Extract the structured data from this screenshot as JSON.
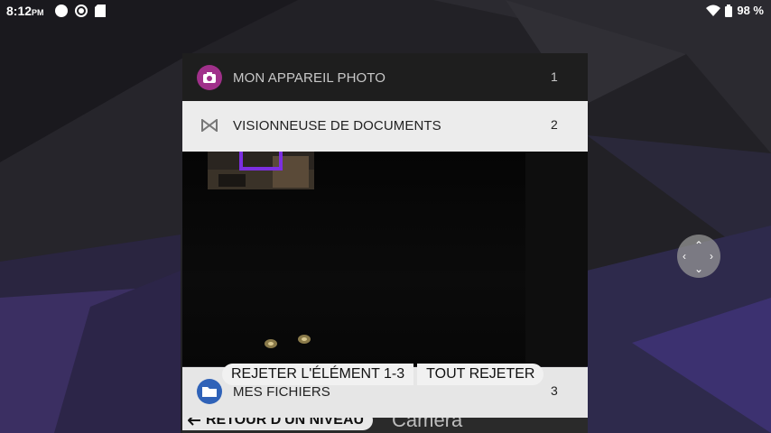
{
  "status_bar": {
    "time": "8:12",
    "ampm": "PM",
    "battery_percent": "98 %"
  },
  "recents": {
    "cards": [
      {
        "title": "MON APPAREIL PHOTO",
        "number": "1",
        "icon": "camera-icon",
        "icon_color": "#a0308a"
      },
      {
        "title": "VISIONNEUSE DE DOCUMENTS",
        "number": "2",
        "icon": "document-viewer-icon",
        "icon_color": "#777777"
      },
      {
        "title": "MES FICHIERS",
        "number": "3",
        "icon": "folder-icon",
        "icon_color": "#2f62b8"
      }
    ],
    "dismiss_item_label": "REJETER L'ÉLÉMENT 1-3",
    "dismiss_all_label": "TOUT REJETER",
    "back_label": "RETOUR D'UN NIVEAU",
    "bottom_app_title": "Camera"
  },
  "colors": {
    "selection_box": "#7c2fe0"
  }
}
